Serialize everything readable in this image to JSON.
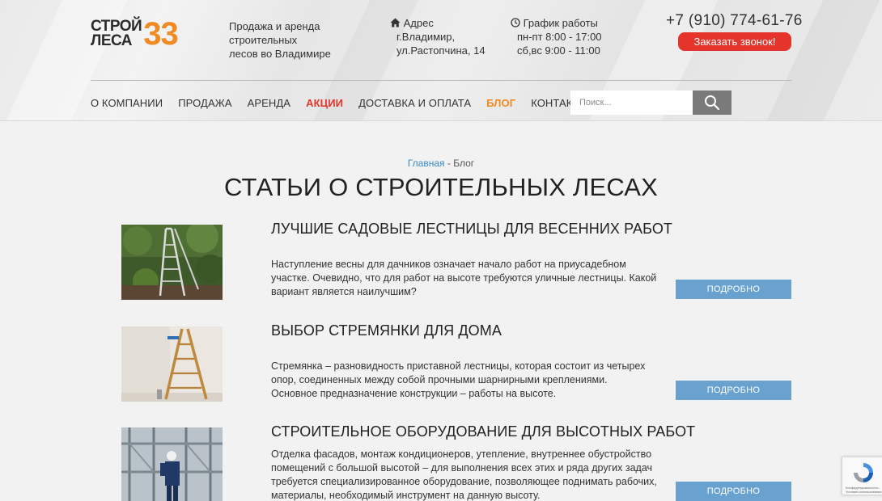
{
  "header": {
    "logo": {
      "text_line1": "СТРОЙ",
      "text_line2": "ЛЕСА",
      "number": "33"
    },
    "tagline_lines": [
      "Продажа и аренда",
      "строительных",
      "лесов во Владимире"
    ],
    "address": {
      "label": "Адрес",
      "line1": "г.Владимир,",
      "line2": "ул.Растопчина, 14"
    },
    "schedule": {
      "label": "График работы",
      "line1": "пн-пт 8:00 - 17:00",
      "line2": "сб,вс 9:00 - 11:00"
    },
    "phone": "+7 (910) 774-61-76",
    "callback_label": "Заказать звонок!"
  },
  "nav": {
    "items": [
      {
        "label": "О КОМПАНИИ"
      },
      {
        "label": "ПРОДАЖА"
      },
      {
        "label": "АРЕНДА"
      },
      {
        "label": "АКЦИИ"
      },
      {
        "label": "ДОСТАВКА И ОПЛАТА"
      },
      {
        "label": "БЛОГ"
      },
      {
        "label": "КОНТАКТЫ"
      }
    ]
  },
  "search": {
    "placeholder": "Поиск..."
  },
  "breadcrumb": {
    "home": "Главная",
    "separator": " - ",
    "current": "Блог"
  },
  "page_title": "СТАТЬИ О СТРОИТЕЛЬНЫХ ЛЕСАХ",
  "articles": [
    {
      "title": "ЛУЧШИЕ САДОВЫЕ ЛЕСТНИЦЫ ДЛЯ ВЕСЕННИХ РАБОТ",
      "text_lines": [
        "Наступление весны для дачников означает начало работ на приусадебном",
        "участке. Очевидно, что для работ на высоте требуются уличные лестницы. Какой",
        "вариант является наилучшим?"
      ],
      "button": "ПОДРОБНО"
    },
    {
      "title": "ВЫБОР СТРЕМЯНКИ ДЛЯ ДОМА",
      "text_lines": [
        "Стремянка – разновидность приставной лестницы, которая состоит из четырех",
        "опор, соединенных между собой прочными шарнирными креплениями.",
        "Основное предназначение конструкции – работы на высоте."
      ],
      "button": "ПОДРОБНО"
    },
    {
      "title": "СТРОИТЕЛЬНОЕ ОБОРУДОВАНИЕ ДЛЯ ВЫСОТНЫХ РАБОТ",
      "text_lines": [
        "Отделка фасадов, монтаж кондиционеров, утепление, внутреннее обустройство",
        "помещений с большой высотой – для выполнения всех этих и ряда других задач",
        "требуется специализированное оборудование, позволяющее поднимать рабочих,",
        "материалы, необходимый инструмент на данную высоту."
      ],
      "button": "ПОДРОБНО"
    }
  ],
  "recaptcha": {
    "small_text": "Конфиденциальность - Условия использования"
  },
  "colors": {
    "accent_orange": "#f08a22",
    "accent_red": "#e4342b",
    "button_blue": "#6aa2cf",
    "link_blue": "#3b89c4"
  }
}
